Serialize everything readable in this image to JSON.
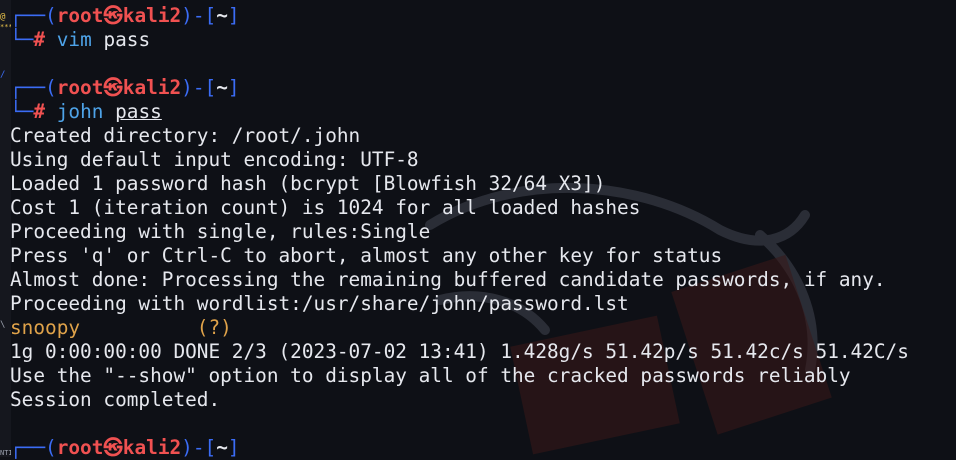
{
  "prompt": {
    "user": "root",
    "at_symbol": "㉿",
    "host": "kali2",
    "cwd": "~",
    "hash": "#"
  },
  "commands": [
    {
      "cmd": "vim",
      "arg": "pass"
    },
    {
      "cmd": "john",
      "arg": "pass"
    }
  ],
  "output": [
    "Created directory: /root/.john",
    "Using default input encoding: UTF-8",
    "Loaded 1 password hash (bcrypt [Blowfish 32/64 X3])",
    "Cost 1 (iteration count) is 1024 for all loaded hashes",
    "Proceeding with single, rules:Single",
    "Press 'q' or Ctrl-C to abort, almost any other key for status",
    "Almost done: Processing the remaining buffered candidate passwords, if any.",
    "Proceeding with wordlist:/usr/share/john/password.lst"
  ],
  "cracked": {
    "password": "snoopy",
    "spacing": "          ",
    "user": "(?)"
  },
  "output_after": [
    "1g 0:00:00:00 DONE 2/3 (2023-07-02 13:41) 1.428g/s 51.42p/s 51.42c/s 51.42C/s",
    "Use the \"--show\" option to display all of the cracked passwords reliably",
    "Session completed."
  ],
  "icons": {
    "dragon": "kali-dragon-logo"
  },
  "colors": {
    "background": "#0e1016",
    "frame": "#3b6cf5",
    "root": "#f05151",
    "command": "#4ea3e8",
    "text": "#e6e8ee",
    "cracked": "#e0a34a"
  }
}
